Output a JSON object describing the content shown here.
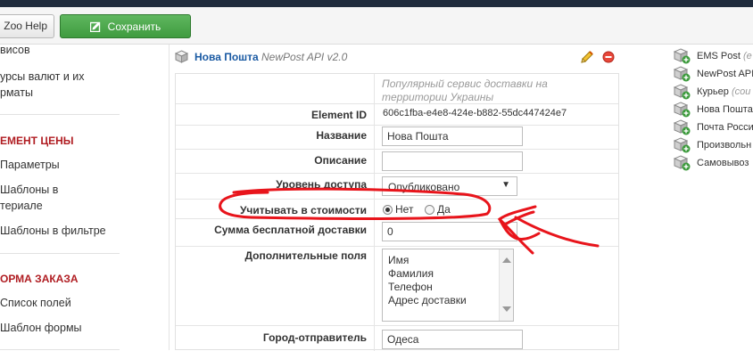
{
  "toolbar": {
    "help_label": "Zoo Help",
    "save_label": "Сохранить"
  },
  "leftnav": {
    "items": [
      {
        "label": "висов"
      },
      {
        "label": "урсы валют и их"
      },
      {
        "label": "рматы"
      }
    ],
    "section_price": {
      "heading": "ЕМЕНТ ЦЕНЫ",
      "items": [
        {
          "label": "Параметры"
        },
        {
          "label": "Шаблоны в"
        },
        {
          "label": "териале"
        },
        {
          "label": "Шаблоны в фильтре"
        }
      ]
    },
    "section_order": {
      "heading": "ОРМА ЗАКАЗА",
      "items": [
        {
          "label": "Список полей"
        },
        {
          "label": "Шаблон формы"
        }
      ]
    }
  },
  "element": {
    "title": "Нова Пошта",
    "subtitle": "NewPost API v2.0",
    "description": "Популярный сервис доставки на территории Украины",
    "rows": {
      "element_id": {
        "label": "Element ID",
        "value": "606c1fba-e4e8-424e-b882-55dc447424e7"
      },
      "name": {
        "label": "Название",
        "value": "Нова Пошта"
      },
      "description": {
        "label": "Описание",
        "value": ""
      },
      "access": {
        "label": "Уровень доступа",
        "value": "Опубликовано"
      },
      "in_cost": {
        "label": "Учитывать в стоимости",
        "options": [
          "Нет",
          "Да"
        ],
        "selected": "Нет"
      },
      "free_amount": {
        "label": "Сумма бесплатной доставки",
        "value": "0"
      },
      "extra_fields": {
        "label": "Дополнительные поля",
        "options": [
          "Имя",
          "Фамилия",
          "Телефон",
          "Адрес доставки"
        ]
      },
      "sender_city": {
        "label": "Город-отправитель",
        "value": "Одеса"
      }
    }
  },
  "right_list": {
    "items": [
      {
        "label": "EMS Post",
        "suffix": "(e"
      },
      {
        "label": "NewPost API",
        "suffix": ""
      },
      {
        "label": "Курьер",
        "suffix": "(cou"
      },
      {
        "label": "Нова Пошта",
        "suffix": ""
      },
      {
        "label": "Почта Росси",
        "suffix": ""
      },
      {
        "label": "Произвольн",
        "suffix": ""
      },
      {
        "label": "Самовывоз",
        "suffix": ""
      }
    ]
  },
  "colors": {
    "save_button": "#47a447",
    "section_heading": "#b01d22",
    "element_title": "#1a5aa3",
    "annotation": "#e8141b",
    "top_bar": "#1f2b3c"
  },
  "icons": {
    "save": "save-icon",
    "element": "cube-icon",
    "edit": "pencil-icon",
    "delete": "minus-circle-icon",
    "add_element": "cube-add-icon"
  }
}
